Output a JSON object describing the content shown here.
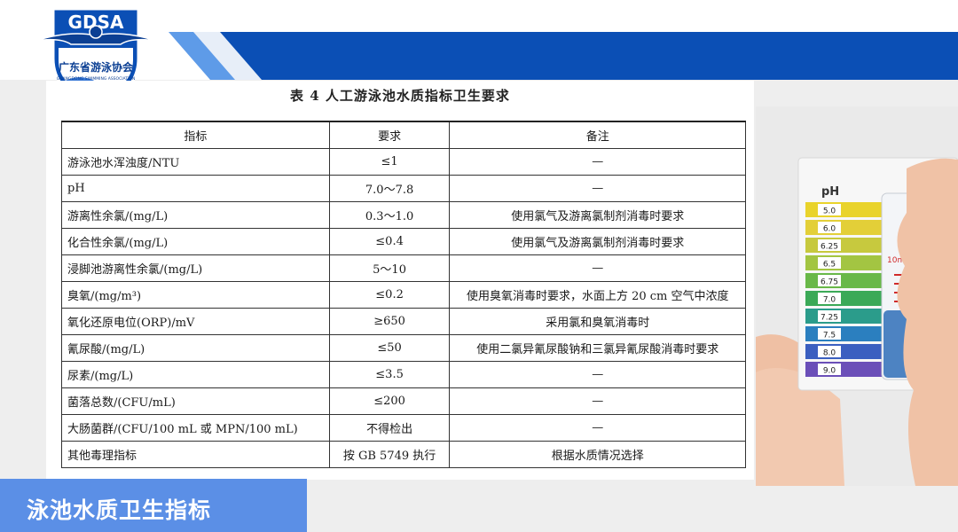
{
  "logo": {
    "acronym": "GDSA",
    "name_cn": "广东省游泳协会",
    "name_en": "GUANGDONG SWIMMING ASSOCIATION"
  },
  "document": {
    "title": "表 4   人工游泳池水质指标卫生要求",
    "headers": [
      "指标",
      "要求",
      "备注"
    ],
    "rows": [
      [
        "游泳池水浑浊度/NTU",
        "≤1",
        "—"
      ],
      [
        "pH",
        "7.0～7.8",
        "—"
      ],
      [
        "游离性余氯/(mg/L)",
        "0.3～1.0",
        "使用氯气及游离氯制剂消毒时要求"
      ],
      [
        "化合性余氯/(mg/L)",
        "≤0.4",
        "使用氯气及游离氯制剂消毒时要求"
      ],
      [
        "浸脚池游离性余氯/(mg/L)",
        "5～10",
        "—"
      ],
      [
        "臭氧/(mg/m³)",
        "≤0.2",
        "使用臭氧消毒时要求，水面上方 20 cm 空气中浓度"
      ],
      [
        "氧化还原电位(ORP)/mV",
        "≥650",
        "采用氯和臭氧消毒时"
      ],
      [
        "氰尿酸/(mg/L)",
        "≤50",
        "使用二氯异氰尿酸钠和三氯异氰尿酸消毒时要求"
      ],
      [
        "尿素/(mg/L)",
        "≤3.5",
        "—"
      ],
      [
        "菌落总数/(CFU/mL)",
        "≤200",
        "—"
      ],
      [
        "大肠菌群/(CFU/100 mL 或 MPN/100 mL)",
        "不得检出",
        "—"
      ],
      [
        "其他毒理指标",
        "按 GB 5749 执行",
        "根据水质情况选择"
      ]
    ]
  },
  "ph_chart": {
    "label": "pH",
    "values": [
      "5.0",
      "6.0",
      "6.25",
      "6.5",
      "6.75",
      "7.0",
      "7.25",
      "7.5",
      "8.0",
      "9.0"
    ],
    "colors": [
      "#e9d32b",
      "#e3cf38",
      "#c7c93e",
      "#a3c542",
      "#69b848",
      "#3ba957",
      "#2b9c8b",
      "#2b7fbf",
      "#3b5fc0",
      "#6b4fb8"
    ],
    "vial_label": "10ml"
  },
  "footer": {
    "title": "泳池水质卫生指标"
  },
  "colors": {
    "banner_blue": "#0b4fb5",
    "banner_light": "#3a79d6",
    "footer_blue": "#5b8fe6"
  }
}
